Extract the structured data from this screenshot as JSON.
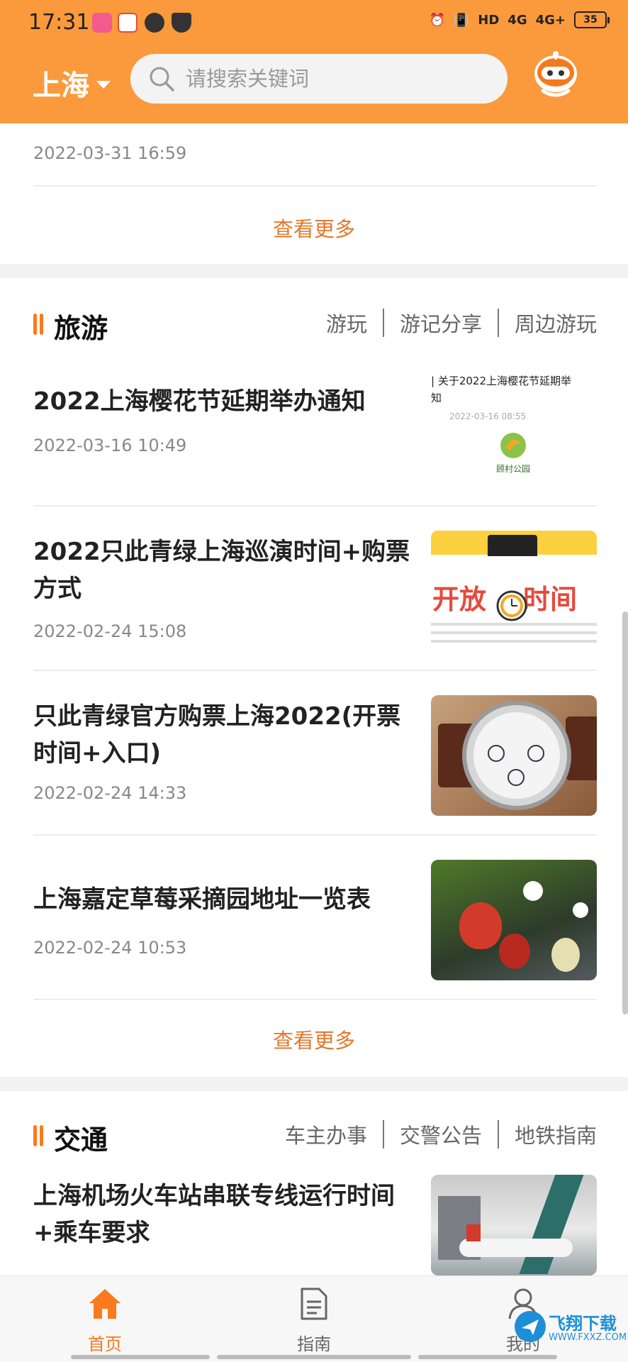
{
  "status_bar": {
    "time": "17:31",
    "network_1": "4G",
    "network_2": "4G+",
    "hd": "HD",
    "battery": "35"
  },
  "header": {
    "city": "上海",
    "search_placeholder": "请搜索关键词"
  },
  "top_card": {
    "date": "2022-03-31 16:59",
    "more": "查看更多"
  },
  "travel": {
    "title": "旅游",
    "tabs": [
      "游玩",
      "游记分享",
      "周边游玩"
    ],
    "articles": [
      {
        "title": "2022上海樱花节延期举办通知",
        "date": "2022-03-16 10:49",
        "thumb": {
          "headline": "| 关于2022上海樱花节延期举",
          "headline2": "知",
          "source_date": "2022-03-16 08:55",
          "logo_text": "顾村公园"
        }
      },
      {
        "title": "2022只此青绿上海巡演时间+购票方式",
        "date": "2022-02-24 15:08",
        "thumb": {
          "left": "开放",
          "right": "时间"
        }
      },
      {
        "title": "只此青绿官方购票上海2022(开票时间+入口)",
        "date": "2022-02-24 14:33",
        "thumb_icon": "watch-image"
      },
      {
        "title": "上海嘉定草莓采摘园地址一览表",
        "date": "2022-02-24 10:53",
        "thumb_icon": "strawberry-image"
      }
    ],
    "more": "查看更多"
  },
  "traffic": {
    "title": "交通",
    "tabs": [
      "车主办事",
      "交警公告",
      "地铁指南"
    ],
    "articles": [
      {
        "title": "上海机场火车站串联专线运行时间+乘车要求",
        "thumb_icon": "airport-image"
      }
    ]
  },
  "tabbar": {
    "items": [
      {
        "label": "首页",
        "icon": "home-icon",
        "active": true
      },
      {
        "label": "指南",
        "icon": "document-icon",
        "active": false
      },
      {
        "label": "我的",
        "icon": "user-icon",
        "active": false
      }
    ]
  },
  "watermark": {
    "text": "飞翔下载",
    "url": "WWW.FXXZ.COM"
  },
  "colors": {
    "accent": "#fb9a3c",
    "link": "#e3782a",
    "active": "#fb7a1e"
  }
}
